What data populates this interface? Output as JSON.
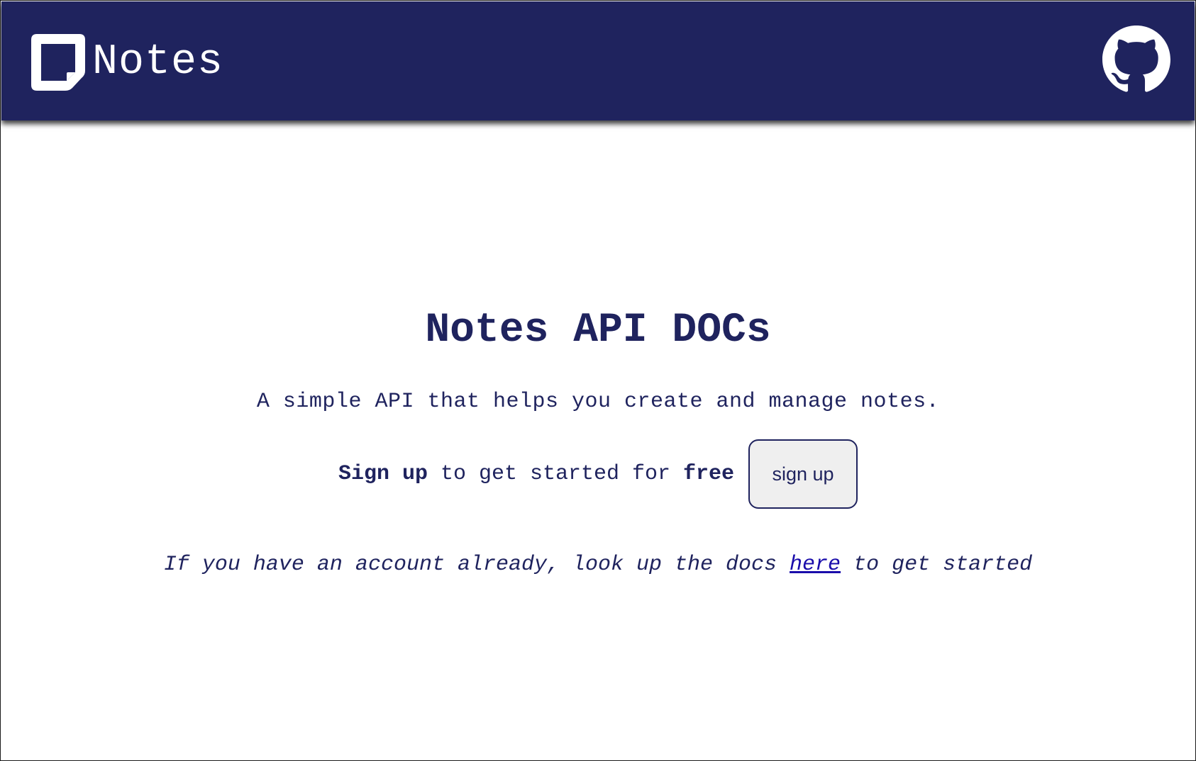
{
  "header": {
    "brand_name": "Notes",
    "logo_icon": "sticky-note-icon",
    "github_icon": "github-icon",
    "background_color": "#1f235e"
  },
  "hero": {
    "title": "Notes API DOCs",
    "subtitle": "A simple API that helps you create and manage notes.",
    "signup_strong_start": "Sign up",
    "signup_middle": " to get started for ",
    "signup_strong_end": "free",
    "signup_button_label": "sign up",
    "existing_prefix": "If you have an account already, look up the docs ",
    "existing_link": "here",
    "existing_suffix": " to get started"
  }
}
